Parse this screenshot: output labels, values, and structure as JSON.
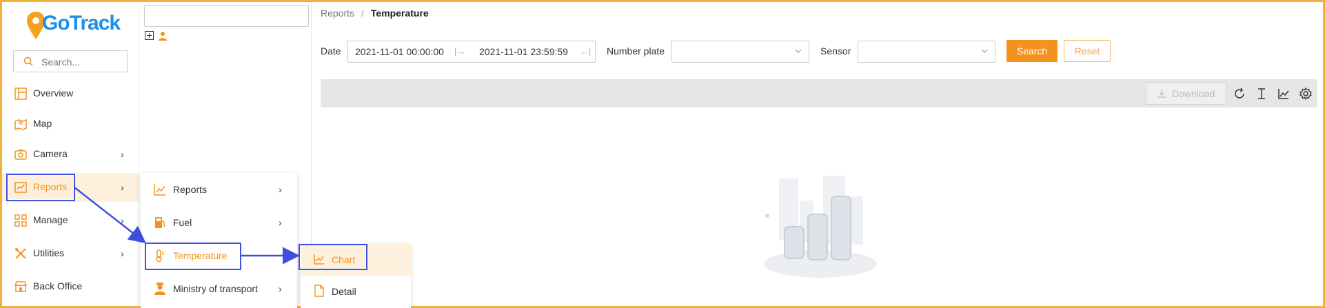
{
  "brand": {
    "logo_text": "GoTrack"
  },
  "sidebar": {
    "search_placeholder": "Search...",
    "items": [
      {
        "label": "Overview",
        "icon": "overview-icon"
      },
      {
        "label": "Map",
        "icon": "map-icon"
      },
      {
        "label": "Camera",
        "icon": "camera-icon"
      },
      {
        "label": "Reports",
        "icon": "reports-icon"
      },
      {
        "label": "Manage",
        "icon": "manage-icon"
      },
      {
        "label": "Utilities",
        "icon": "utilities-icon"
      },
      {
        "label": "Back Office",
        "icon": "back-office-icon"
      }
    ]
  },
  "reports_submenu": {
    "items": [
      {
        "label": "Reports"
      },
      {
        "label": "Fuel"
      },
      {
        "label": "Temperature"
      },
      {
        "label": "Ministry of transport"
      }
    ]
  },
  "temperature_submenu": {
    "items": [
      {
        "label": "Chart"
      },
      {
        "label": "Detail"
      }
    ]
  },
  "breadcrumb": {
    "parent": "Reports",
    "separator": "/",
    "current": "Temperature"
  },
  "filters": {
    "date_label": "Date",
    "date_from": "2021-11-01 00:00:00",
    "date_to": "2021-11-01 23:59:59",
    "number_plate_label": "Number plate",
    "sensor_label": "Sensor",
    "search_label": "Search",
    "reset_label": "Reset"
  },
  "toolbar": {
    "download_label": "Download"
  },
  "colors": {
    "accent": "#f5921e",
    "highlight": "#3d4fe0",
    "logo": "#1e8fe8"
  }
}
